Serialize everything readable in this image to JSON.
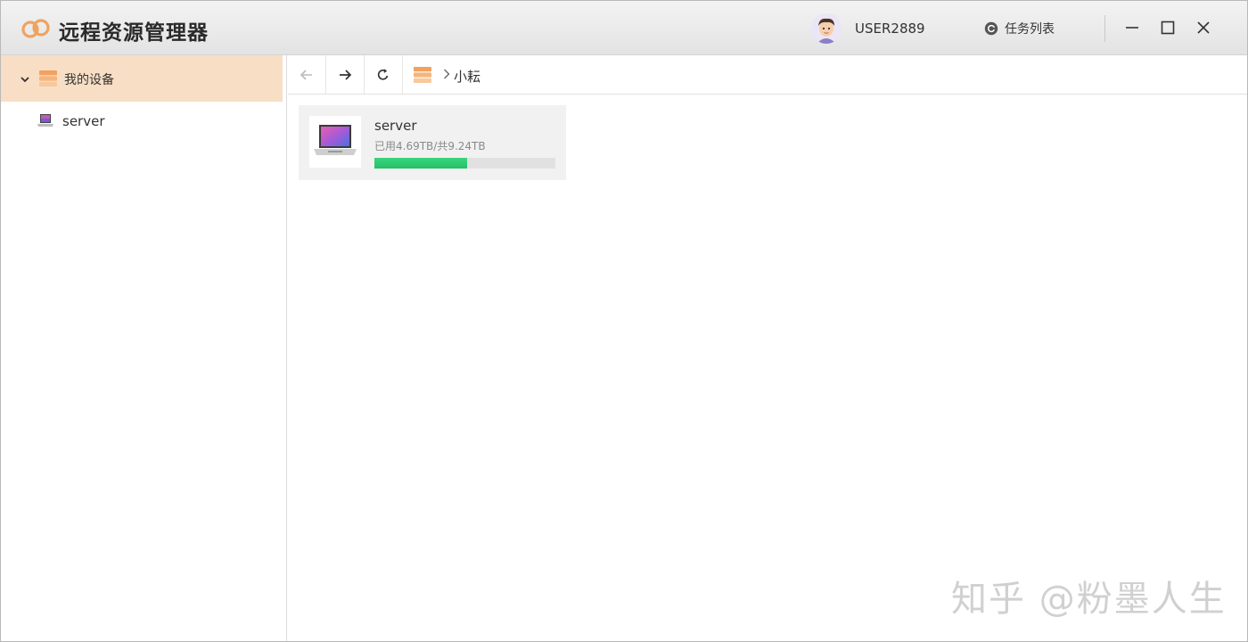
{
  "app": {
    "title": "远程资源管理器",
    "accent_color": "#f0a35e",
    "logo_icon": "chain-link-logo"
  },
  "header": {
    "username": "USER2889",
    "avatar_icon": "user-avatar",
    "task_list_label": "任务列表",
    "task_list_icon": "refresh-circle-icon",
    "window_controls": [
      "minimize-icon",
      "maximize-icon",
      "close-icon"
    ]
  },
  "sidebar": {
    "group": {
      "label": "我的设备",
      "expanded": true,
      "icon": "devices-icon",
      "highlight_color": "#f8dec5"
    },
    "items": [
      {
        "label": "server",
        "icon": "laptop-icon"
      }
    ]
  },
  "toolbar": {
    "back_icon": "arrow-left-icon",
    "forward_icon": "arrow-right-icon",
    "refresh_icon": "refresh-icon",
    "breadcrumb": {
      "root_icon": "devices-icon",
      "current": "小耘"
    }
  },
  "devices": [
    {
      "name": "server",
      "usage_text": "已用4.69TB/共9.24TB",
      "used_tb": 4.69,
      "total_tb": 9.24,
      "usage_fraction": 0.51,
      "bar_color": "#2ecc71"
    }
  ],
  "watermark": "知乎 @粉墨人生"
}
